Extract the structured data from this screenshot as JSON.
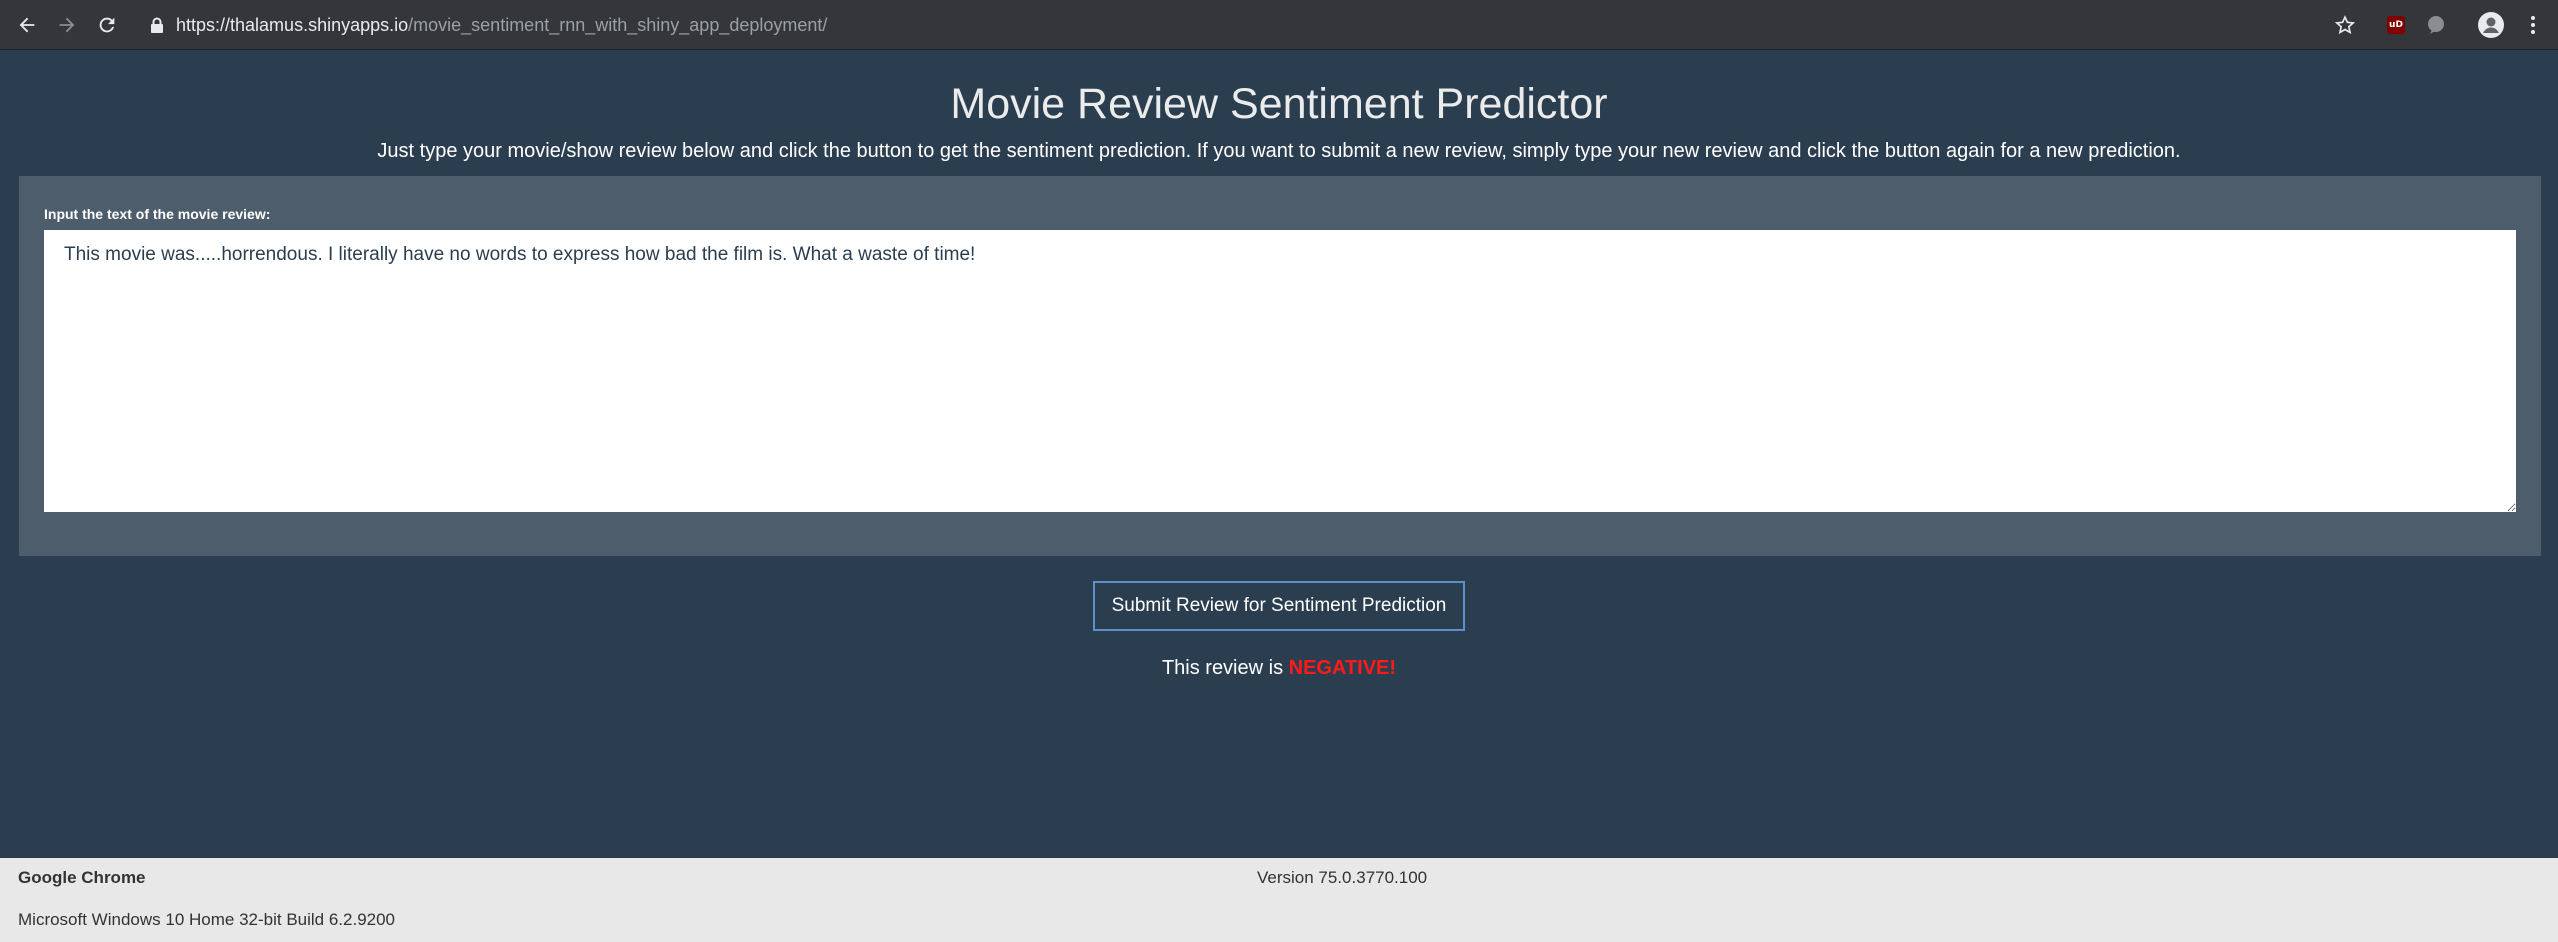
{
  "browser": {
    "url_host": "https://thalamus.shinyapps.io",
    "url_path": "/movie_sentiment_rnn_with_shiny_app_deployment/",
    "extension_badge": "uD"
  },
  "page": {
    "title": "Movie Review Sentiment Predictor",
    "subtitle": "Just type your movie/show review below and click the button to get the sentiment prediction. If you want to submit a new review, simply type your new review and click the button again for a new prediction.",
    "input_label": "Input the text of the movie review:",
    "review_text": "This movie was.....horrendous. I literally have no words to express how bad the film is. What a waste of time!",
    "submit_label": "Submit Review for Sentiment Prediction",
    "result_prefix": "This review is ",
    "result_value": "NEGATIVE!"
  },
  "footer": {
    "app_name": "Google Chrome",
    "version": "Version 75.0.3770.100",
    "os": "Microsoft Windows 10 Home 32-bit Build 6.2.9200"
  },
  "colors": {
    "background": "#2b3e50",
    "panel": "#4e5d6c",
    "negative": "#ff1a1a",
    "button_border": "#5f8fc9"
  }
}
